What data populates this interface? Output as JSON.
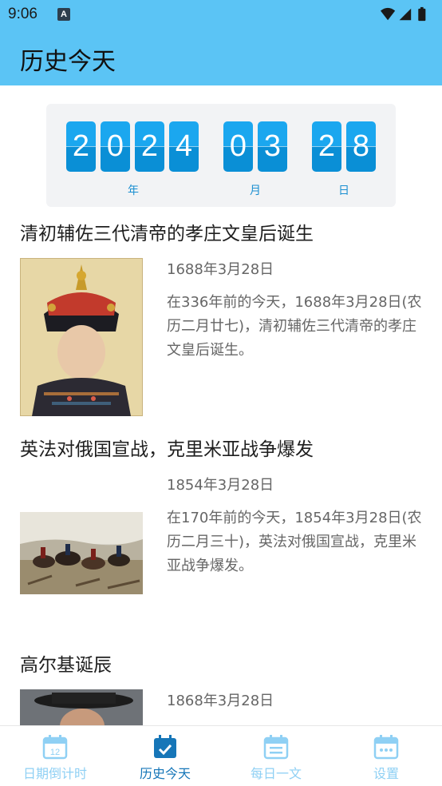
{
  "status_bar": {
    "time": "9:06",
    "notification_icon_label": "A"
  },
  "app_bar": {
    "title": "历史今天"
  },
  "date_display": {
    "year_digits": [
      "2",
      "0",
      "2",
      "4"
    ],
    "month_digits": [
      "0",
      "3"
    ],
    "day_digits": [
      "2",
      "8"
    ],
    "year_unit": "年",
    "month_unit": "月",
    "day_unit": "日",
    "digit_color": "#1ba7ef"
  },
  "events": [
    {
      "title": "清初辅佐三代清帝的孝庄文皇后诞生",
      "date": "1688年3月28日",
      "description": "在336年前的今天，1688年3月28日(农历二月廿七)，清初辅佐三代清帝的孝庄文皇后诞生。",
      "image": "portrait-empress"
    },
    {
      "title": "英法对俄国宣战，克里米亚战争爆发",
      "date": "1854年3月28日",
      "description": "在170年前的今天，1854年3月28日(农历二月三十)，英法对俄国宣战，克里米亚战争爆发。",
      "image": "cavalry-battle-painting"
    },
    {
      "title": "高尔基诞辰",
      "date": "1868年3月28日",
      "description": "",
      "image": "portrait-gorky"
    }
  ],
  "tabs": [
    {
      "label": "日期倒计时",
      "icon": "calendar-12-icon",
      "icon_text": "12",
      "active": false
    },
    {
      "label": "历史今天",
      "icon": "calendar-check-icon",
      "active": true
    },
    {
      "label": "每日一文",
      "icon": "calendar-lines-icon",
      "active": false
    },
    {
      "label": "设置",
      "icon": "calendar-dots-icon",
      "active": false
    }
  ],
  "colors": {
    "app_bar": "#5bc4f5",
    "tab_active": "#1676b8",
    "tab_inactive": "#8fd0f4"
  }
}
